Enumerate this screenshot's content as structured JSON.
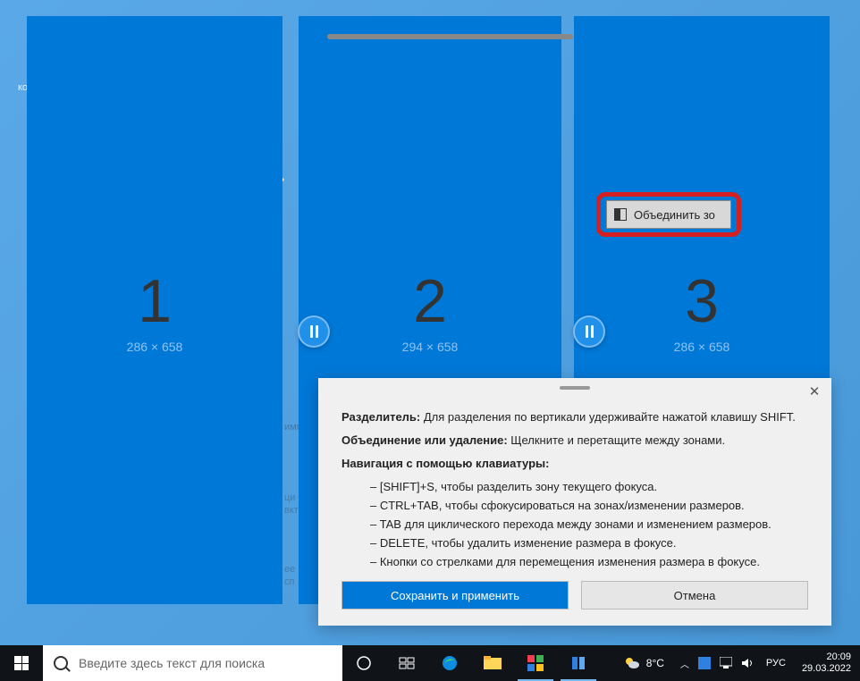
{
  "desktop": {
    "blur1": "ко",
    "blur2": "ль",
    "blur3a": "имп",
    "blur4a": "ци",
    "blur4b": "вкт",
    "blur5a": "ее",
    "blur5b": "сп"
  },
  "zones": [
    {
      "number": "1",
      "dims": "286 × 658"
    },
    {
      "number": "2",
      "dims": "294 × 658"
    },
    {
      "number": "3",
      "dims": "286 × 658"
    }
  ],
  "merge_button": "Объединить зо",
  "help": {
    "row1_label": "Разделитель:",
    "row1_text": " Для разделения по вертикали удерживайте нажатой клавишу SHIFT.",
    "row2_label": "Объединение или удаление:",
    "row2_text": " Щелкните и перетащите между зонами.",
    "row3_label": "Навигация с помощью клавиатуры:",
    "items": [
      "– [SHIFT]+S, чтобы разделить зону текущего фокуса.",
      "– CTRL+TAB, чтобы сфокусироваться на зонах/изменении размеров.",
      "– TAB для циклического перехода между зонами и изменением размеров.",
      "– DELETE, чтобы удалить изменение размера в фокусе.",
      "– Кнопки со стрелками для перемещения изменения размера в фокусе."
    ],
    "apply": "Сохранить и применить",
    "cancel": "Отмена"
  },
  "taskbar": {
    "search_placeholder": "Введите здесь текст для поиска",
    "weather_temp": "8°C",
    "lang": "РУС",
    "time": "20:09",
    "date": "29.03.2022"
  }
}
